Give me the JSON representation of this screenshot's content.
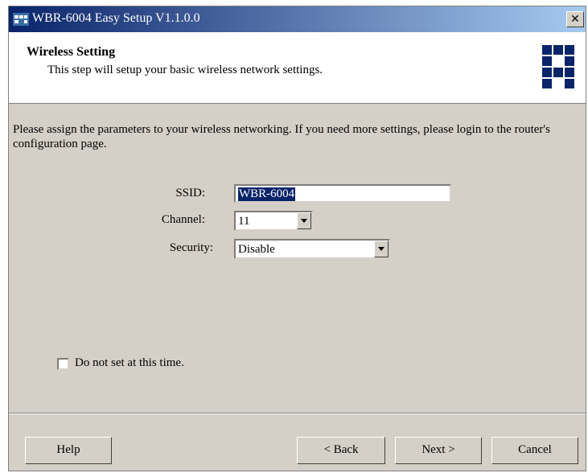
{
  "window": {
    "title": "WBR-6004 Easy Setup  V1.1.0.0",
    "close_label": "✕"
  },
  "header": {
    "title": "Wireless Setting",
    "subtitle": "This step will setup your basic wireless network settings."
  },
  "intro": "Please assign the parameters to your wireless networking. If you need more settings, please login to the router's configuration page.",
  "form": {
    "ssid_label": "SSID:",
    "ssid_value": "WBR-6004",
    "channel_label": "Channel:",
    "channel_value": "11",
    "security_label": "Security:",
    "security_value": "Disable"
  },
  "checkbox": {
    "label": "Do not set at this time.",
    "checked": false
  },
  "buttons": {
    "help": "Help",
    "back": "< Back",
    "next": "Next >",
    "cancel": "Cancel"
  },
  "colors": {
    "titlebar_start": "#0a246a",
    "titlebar_end": "#a6caf0",
    "dialog_bg": "#d4d0c8",
    "selection": "#0a246a"
  }
}
